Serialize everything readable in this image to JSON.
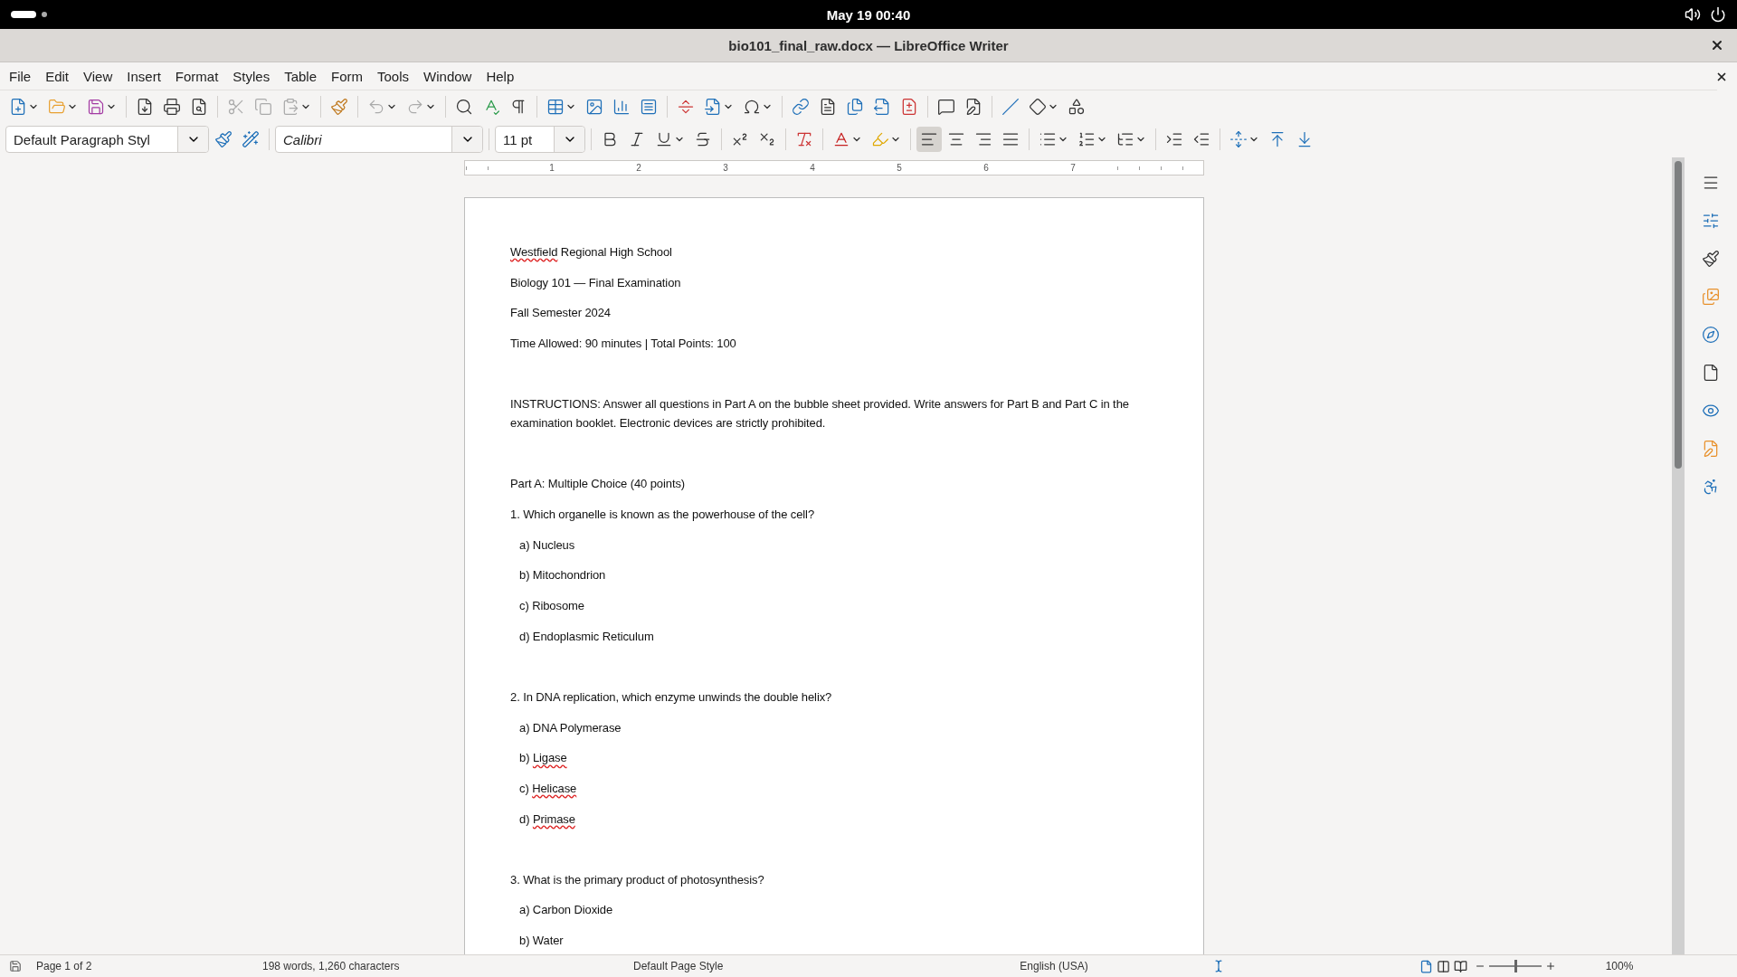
{
  "system_bar": {
    "clock": "May 19  00:40"
  },
  "window": {
    "title": "bio101_final_raw.docx — LibreOffice Writer"
  },
  "menu": [
    "File",
    "Edit",
    "View",
    "Insert",
    "Format",
    "Styles",
    "Table",
    "Form",
    "Tools",
    "Window",
    "Help"
  ],
  "formatting": {
    "paragraph_style": "Default Paragraph Styl",
    "font_name": "Calibri",
    "font_size": "11 pt",
    "alignment": [
      {
        "kind": "left",
        "selected": true
      },
      {
        "kind": "center",
        "selected": false
      },
      {
        "kind": "right",
        "selected": false
      },
      {
        "kind": "justify",
        "selected": false
      }
    ]
  },
  "ruler": {
    "labels": [
      "1",
      "2",
      "3",
      "4",
      "5",
      "6",
      "7"
    ]
  },
  "document": {
    "paragraphs": [
      {
        "kind": "line",
        "parts": [
          {
            "text": "Westfield",
            "misspelled": true
          },
          {
            "text": " Regional High School",
            "misspelled": false
          }
        ]
      },
      {
        "kind": "line",
        "parts": [
          {
            "text": "Biology 101 — Final Examination",
            "misspelled": false
          }
        ]
      },
      {
        "kind": "line",
        "parts": [
          {
            "text": "Fall Semester 2024",
            "misspelled": false
          }
        ]
      },
      {
        "kind": "line",
        "parts": [
          {
            "text": "Time Allowed: 90 minutes | Total Points: 100",
            "misspelled": false
          }
        ]
      },
      {
        "kind": "blank"
      },
      {
        "kind": "line",
        "parts": [
          {
            "text": "INSTRUCTIONS: Answer all questions in Part A on the bubble sheet provided. Write answers for Part B and Part C in the examination booklet. Electronic devices are strictly prohibited.",
            "misspelled": false
          }
        ]
      },
      {
        "kind": "blank"
      },
      {
        "kind": "line",
        "parts": [
          {
            "text": "Part A: Multiple Choice (40 points)",
            "misspelled": false
          }
        ]
      },
      {
        "kind": "line",
        "parts": [
          {
            "text": "1. Which organelle is known as the powerhouse of the cell?",
            "misspelled": false
          }
        ]
      },
      {
        "kind": "option",
        "parts": [
          {
            "text": "a) Nucleus",
            "misspelled": false
          }
        ]
      },
      {
        "kind": "option",
        "parts": [
          {
            "text": "b) Mitochondrion",
            "misspelled": false
          }
        ]
      },
      {
        "kind": "option",
        "parts": [
          {
            "text": "c) Ribosome",
            "misspelled": false
          }
        ]
      },
      {
        "kind": "option",
        "parts": [
          {
            "text": "d) Endoplasmic Reticulum",
            "misspelled": false
          }
        ]
      },
      {
        "kind": "blank"
      },
      {
        "kind": "line",
        "parts": [
          {
            "text": "2. In DNA replication, which enzyme unwinds the double helix?",
            "misspelled": false
          }
        ]
      },
      {
        "kind": "option",
        "parts": [
          {
            "text": "a) DNA Polymerase",
            "misspelled": false
          }
        ]
      },
      {
        "kind": "option",
        "parts": [
          {
            "text": "b) ",
            "misspelled": false
          },
          {
            "text": "Ligase",
            "misspelled": true
          }
        ]
      },
      {
        "kind": "option",
        "parts": [
          {
            "text": "c) ",
            "misspelled": false
          },
          {
            "text": "Helicase",
            "misspelled": true
          }
        ]
      },
      {
        "kind": "option",
        "parts": [
          {
            "text": "d) ",
            "misspelled": false
          },
          {
            "text": "Primase",
            "misspelled": true
          }
        ]
      },
      {
        "kind": "blank"
      },
      {
        "kind": "line",
        "parts": [
          {
            "text": "3. What is the primary product of photosynthesis?",
            "misspelled": false
          }
        ]
      },
      {
        "kind": "option",
        "parts": [
          {
            "text": "a) Carbon Dioxide",
            "misspelled": false
          }
        ]
      },
      {
        "kind": "option",
        "parts": [
          {
            "text": "b) Water",
            "misspelled": false
          }
        ]
      }
    ]
  },
  "status_bar": {
    "page": "Page 1 of 2",
    "counts": "198 words, 1,260 characters",
    "page_style": "Default Page Style",
    "language": "English (USA)",
    "zoom": {
      "level": 0.5,
      "reading": "100%"
    }
  }
}
